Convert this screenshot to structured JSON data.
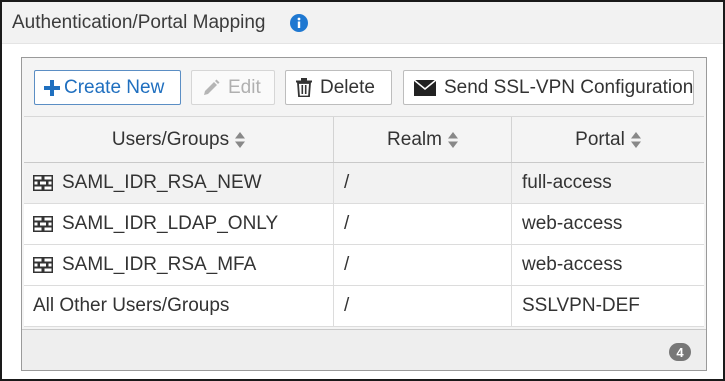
{
  "section": {
    "title": "Authentication/Portal Mapping",
    "info_icon": "info-circle-icon"
  },
  "toolbar": {
    "create_label": "Create New",
    "edit_label": "Edit",
    "delete_label": "Delete",
    "send_label": "Send SSL-VPN Configuration"
  },
  "table": {
    "columns": [
      "Users/Groups",
      "Realm",
      "Portal"
    ],
    "rows": [
      {
        "user_group": "SAML_IDR_RSA_NEW",
        "realm": "/",
        "portal": "full-access",
        "icon": "firewall-group-icon",
        "selected": true
      },
      {
        "user_group": "SAML_IDR_LDAP_ONLY",
        "realm": "/",
        "portal": "web-access",
        "icon": "firewall-group-icon"
      },
      {
        "user_group": "SAML_IDR_RSA_MFA",
        "realm": "/",
        "portal": "web-access",
        "icon": "firewall-group-icon"
      },
      {
        "user_group": "All Other Users/Groups",
        "realm": "/",
        "portal": "SSLVPN-DEF",
        "icon": ""
      }
    ]
  },
  "footer": {
    "count": "4"
  },
  "colors": {
    "accent": "#1f6fbf",
    "info": "#1f78d1",
    "badge": "#777777"
  }
}
